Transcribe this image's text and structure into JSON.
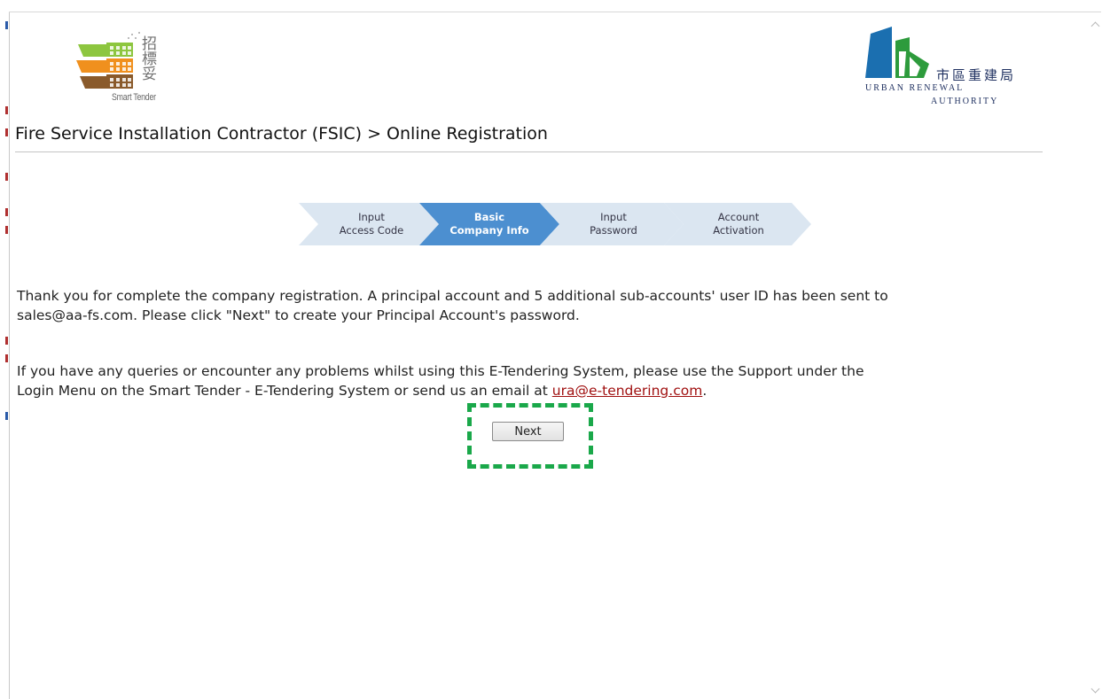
{
  "logos": {
    "smart_tender": {
      "hanzi": [
        "招",
        "標",
        "妥"
      ],
      "caption": "Smart Tender"
    },
    "ura": {
      "hanzi": "市區重建局",
      "english_line1": "URBAN RENEWAL",
      "english_line2": "AUTHORITY"
    }
  },
  "page": {
    "title": "Fire Service Installation Contractor (FSIC) > Online Registration"
  },
  "steps": [
    {
      "line1": "Input",
      "line2": "Access Code",
      "active": false
    },
    {
      "line1": "Basic",
      "line2": "Company Info",
      "active": true
    },
    {
      "line1": "Input",
      "line2": "Password",
      "active": false
    },
    {
      "line1": "Account",
      "line2": "Activation",
      "active": false
    }
  ],
  "messages": {
    "confirmation_line1": "Thank you for complete the company registration. A principal account and 5 additional sub-accounts' user ID has been sent to",
    "confirmation_line2": "sales@aa-fs.com. Please click \"Next\" to create your Principal Account's password.",
    "support_line1": "If you have any queries or encounter any problems whilst using this E-Tendering System, please use the Support under the",
    "support_line2_prefix": "Login Menu on the Smart Tender - E-Tendering System or send us an email at ",
    "support_email": "ura@e-tendering.com",
    "support_line2_suffix": "."
  },
  "buttons": {
    "next_label": "Next"
  },
  "colors": {
    "step_inactive": "#dbe6f1",
    "step_active": "#4c8fd0",
    "highlight": "#1aa84a",
    "link": "#a01010"
  }
}
